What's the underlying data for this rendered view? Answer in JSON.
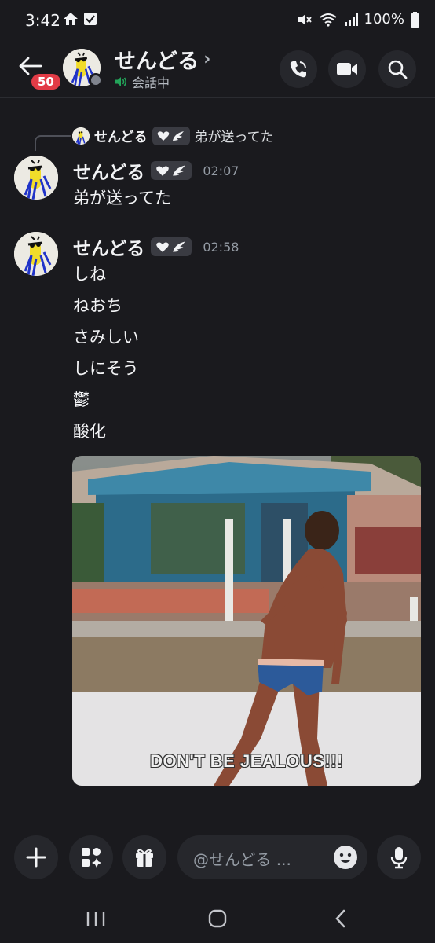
{
  "status_bar": {
    "time": "3:42",
    "battery": "100%"
  },
  "header": {
    "unread_count": "50",
    "name": "せんどる",
    "chevron": "›",
    "status": "会話中"
  },
  "reply": {
    "name": "せんどる",
    "text": "弟が送ってた"
  },
  "messages": [
    {
      "author": "せんどる",
      "time": "02:07",
      "lines": [
        "弟が送ってた"
      ]
    },
    {
      "author": "せんどる",
      "time": "02:58",
      "lines": [
        "しね",
        "ねおち",
        "さみしい",
        "しにそう",
        "鬱",
        "酸化"
      ]
    }
  ],
  "gif": {
    "caption": "DON'T BE JEALOUS!!!"
  },
  "composer": {
    "placeholder": "@せんどる ..."
  },
  "icons": {
    "header": [
      "back-arrow-icon",
      "voice-call-icon",
      "video-call-icon",
      "search-icon"
    ],
    "composer": [
      "plus-icon",
      "apps-icon",
      "gift-icon",
      "emoji-icon",
      "microphone-icon"
    ],
    "nav": [
      "recents-icon",
      "home-icon",
      "back-icon"
    ]
  },
  "colors": {
    "background": "#1a1a1e",
    "badge": "#e23b46",
    "speaking": "#23a55a",
    "button": "#26272c"
  }
}
